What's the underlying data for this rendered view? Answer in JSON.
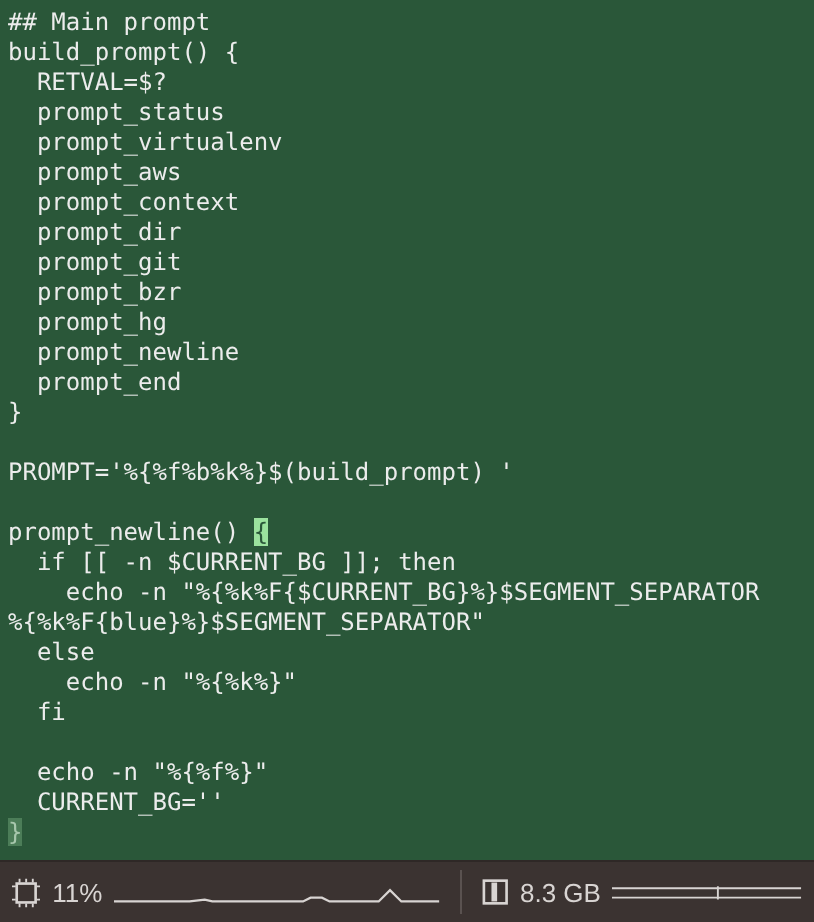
{
  "editor": {
    "blocks": [
      {
        "lines": [
          {
            "text": "## Main prompt"
          },
          {
            "text": "build_prompt() {"
          },
          {
            "text": "  RETVAL=$?"
          },
          {
            "text": "  prompt_status"
          },
          {
            "text": "  prompt_virtualenv"
          },
          {
            "text": "  prompt_aws"
          },
          {
            "text": "  prompt_context"
          },
          {
            "text": "  prompt_dir"
          },
          {
            "text": "  prompt_git"
          },
          {
            "text": "  prompt_bzr"
          },
          {
            "text": "  prompt_hg"
          },
          {
            "text": "  prompt_newline"
          },
          {
            "text": "  prompt_end"
          },
          {
            "text": "}"
          }
        ]
      },
      {
        "lines": [
          {
            "text": "PROMPT='%{%f%b%k%}$(build_prompt) '"
          }
        ]
      },
      {
        "lines": [
          {
            "text": "prompt_newline() ",
            "highlight": {
              "text": "{",
              "kind": "cursor"
            }
          },
          {
            "text": "  if [[ -n $CURRENT_BG ]]; then"
          },
          {
            "text": "    echo -n \"%{%k%F{$CURRENT_BG}%}$SEGMENT_SEPARATOR"
          },
          {
            "text": "%{%k%F{blue}%}$SEGMENT_SEPARATOR\""
          },
          {
            "text": "  else"
          },
          {
            "text": "    echo -n \"%{%k%}\""
          },
          {
            "text": "  fi"
          }
        ]
      },
      {
        "lines": [
          {
            "text": "  echo -n \"%{%f%}\""
          },
          {
            "text": "  CURRENT_BG=''"
          },
          {
            "highlight": {
              "text": "}",
              "kind": "match"
            }
          }
        ]
      }
    ]
  },
  "status_bar": {
    "cpu": "11%",
    "memory": "8.3 GB"
  }
}
